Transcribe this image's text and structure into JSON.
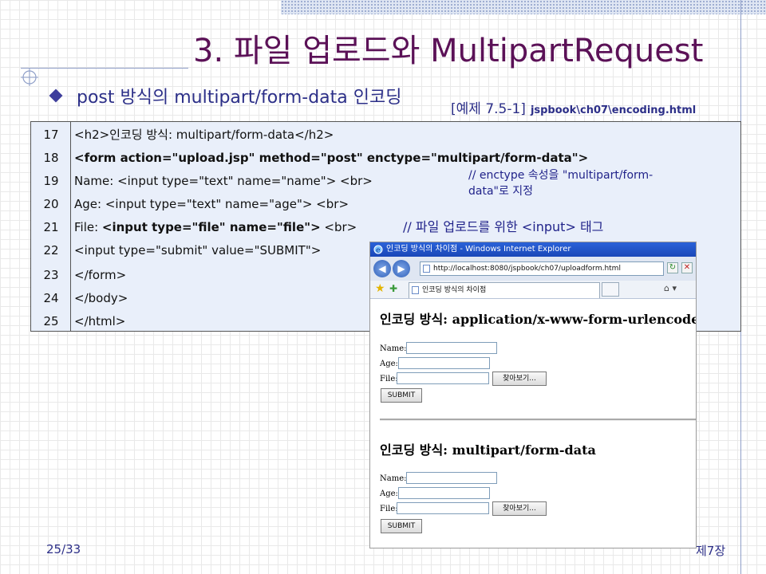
{
  "slide": {
    "title": "3. 파일 업로드와 MultipartRequest",
    "bullet": "post 방식의 multipart/form-data 인코딩",
    "example_label": "[예제 7.5-1]",
    "example_path": "jspbook\\ch07\\encoding.html",
    "page_number": "25/33",
    "chapter": "제7장"
  },
  "code": {
    "lines": [
      {
        "num": "17",
        "text": "<h2>인코딩 방식: multipart/form-data</h2>",
        "bold": false
      },
      {
        "num": "18",
        "text": "<form action=\"upload.jsp\" method=\"post\" enctype=\"multipart/form-data\">",
        "bold": true
      },
      {
        "num": "19",
        "text": "Name: <input type=\"text\" name=\"name\"> <br>",
        "bold": false
      },
      {
        "num": "20",
        "text": "Age: <input type=\"text\" name=\"age\"> <br>",
        "bold": false
      },
      {
        "num": "21",
        "text_plain": "File: ",
        "text_bold": "<input type=\"file\" name=\"file\">",
        "text_tail": " <br>",
        "bold": false
      },
      {
        "num": "22",
        "text": "<input type=\"submit\" value=\"SUBMIT\">",
        "bold": false
      },
      {
        "num": "23",
        "text": "</form>",
        "bold": false
      },
      {
        "num": "24",
        "text": "</body>",
        "bold": false
      },
      {
        "num": "25",
        "text": "</html>",
        "bold": false
      }
    ],
    "comment_enctype_1": "// enctype 속성을 \"multipart/form-",
    "comment_enctype_2": "data\"로 지정",
    "comment_file": "// 파일 업로드를 위한 <input> 태그"
  },
  "browser": {
    "window_title": "인코딩 방식의 차이점 - Windows Internet Explorer",
    "address": "http://localhost:8080/jspbook/ch07/uploadform.html",
    "tab_title": "인코딩 방식의 차이점",
    "section1_heading": "인코딩 방식: application/x-www-form-urlencoded",
    "section2_heading": "인코딩 방식: multipart/form-data",
    "name_label": "Name:",
    "age_label": "Age:",
    "file_label": "File:",
    "browse_button": "찾아보기...",
    "submit_button": "SUBMIT"
  }
}
